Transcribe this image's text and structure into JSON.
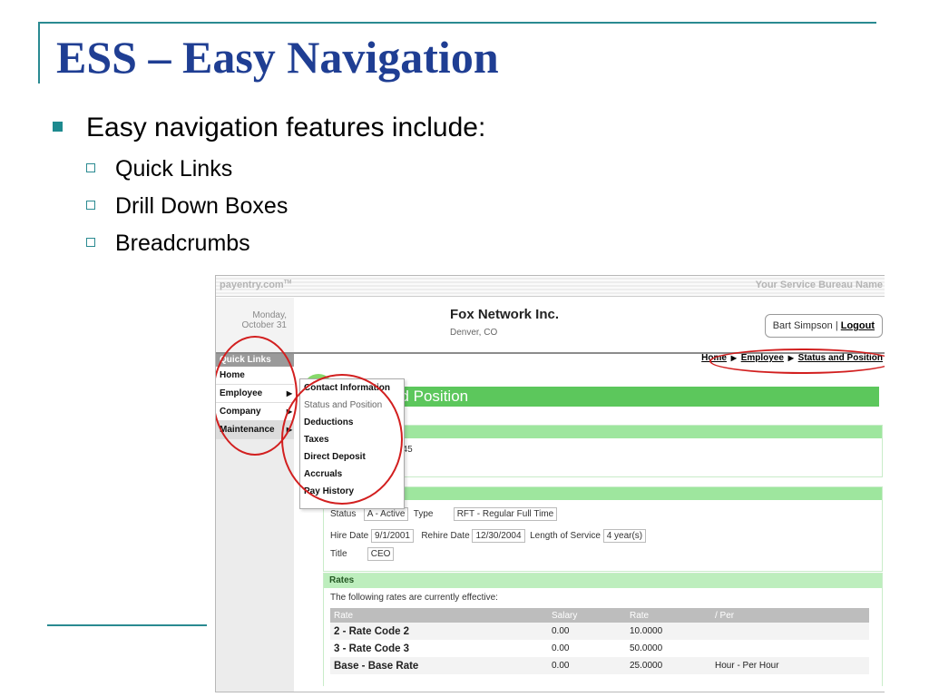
{
  "slide": {
    "title": "ESS – Easy Navigation",
    "bullet": "Easy navigation features include:",
    "subbullets": [
      "Quick Links",
      "Drill Down Boxes",
      "Breadcrumbs"
    ]
  },
  "app": {
    "brand": "payentry.com",
    "brand_tm": "TM",
    "service_bureau": "Your Service Bureau Name",
    "date": {
      "day": "Monday,",
      "date": "October 31"
    },
    "company_name": "Fox Network Inc.",
    "company_city": "Denver, CO",
    "user": {
      "name": "Bart Simpson",
      "separator": "|",
      "logout": "Logout"
    },
    "quick_links": {
      "header": "Quick Links",
      "items": [
        {
          "label": "Home",
          "arrow": ""
        },
        {
          "label": "Employee",
          "arrow": "▶"
        },
        {
          "label": "Company",
          "arrow": "▶"
        },
        {
          "label": "Maintenance",
          "arrow": "▶"
        }
      ]
    },
    "breadcrumb": {
      "items": [
        "Home",
        "Employee",
        "Status and Position"
      ],
      "separator": "▶"
    },
    "page_heading_partial": "nd Position",
    "dropdown": [
      "Contact Information",
      "Status and Position",
      "Deductions",
      "Taxes",
      "Direct Deposit",
      "Accruals",
      "Pay History"
    ],
    "employee_id_partial": "345",
    "status_fields": {
      "status_label": "Status",
      "status_value": "A - Active",
      "type_label": "Type",
      "type_value": "RFT - Regular Full Time",
      "hire_label": "Hire Date",
      "hire_value": "9/1/2001",
      "rehire_label": "Rehire Date",
      "rehire_value": "12/30/2004",
      "los_label": "Length of Service",
      "los_value": "4 year(s)",
      "title_label": "Title",
      "title_value": "CEO"
    },
    "rates": {
      "label": "Rates",
      "note": "The following rates are currently effective:",
      "columns": [
        "Rate",
        "Salary",
        "Rate",
        "/ Per"
      ],
      "rows": [
        [
          "2 - Rate Code 2",
          "0.00",
          "10.0000",
          ""
        ],
        [
          "3 - Rate Code 3",
          "0.00",
          "50.0000",
          ""
        ],
        [
          "Base - Base Rate",
          "0.00",
          "25.0000",
          "Hour - Per Hour"
        ]
      ]
    }
  },
  "colors": {
    "title": "#1f3e93",
    "frame": "#2a8a91",
    "accent_green": "#5cc75c",
    "annotation_red": "#d21f1f"
  }
}
